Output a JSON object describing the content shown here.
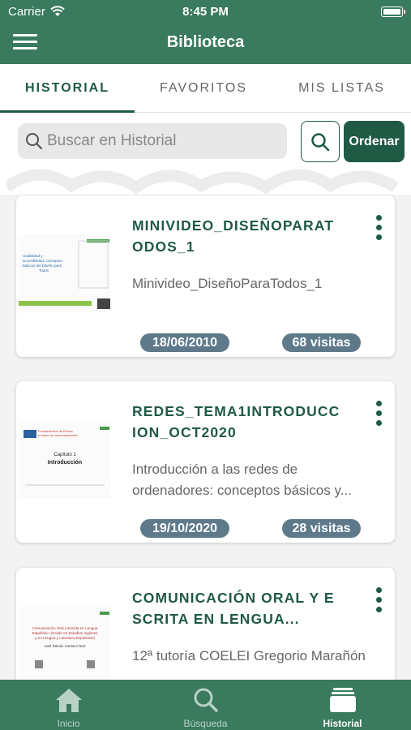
{
  "status_bar": {
    "carrier": "Carrier",
    "time": "8:45 PM"
  },
  "header": {
    "title": "Biblioteca",
    "menu_icon": "hamburger-menu-icon"
  },
  "tabs": [
    {
      "label": "HISTORIAL",
      "active": true
    },
    {
      "label": "FAVORITOS",
      "active": false
    },
    {
      "label": "MIS LISTAS",
      "active": false
    }
  ],
  "search": {
    "placeholder": "Buscar en Historial",
    "value": "",
    "button_icon": "search-icon",
    "order_label": "Ordenar"
  },
  "items": [
    {
      "title": "MINIVIDEO_DISEÑOPARATODOS_1",
      "description": "Minivideo_DiseñoParaTodos_1",
      "date": "18/06/2010",
      "visits": "68 visitas"
    },
    {
      "title": "REDES_TEMA1INTRODUCCION_OCT2020",
      "description": "Introducción a las redes de ordenadores: conceptos básicos y...",
      "date": "19/10/2020",
      "visits": "28 visitas"
    },
    {
      "title": "COMUNICACIÓN ORAL Y ESCRITA EN LENGUA...",
      "description": "12ª tutoría COELEI Gregorio Marañón",
      "date": "",
      "visits": ""
    }
  ],
  "thumbnails": {
    "t1": [
      "Usabilidad y",
      "accesibilidad: conceptos",
      "básicos del Diseño para",
      "Todos"
    ],
    "t2": [
      "Fundamentos de Redes",
      "y redes de comunicaciones",
      "Capítulo 1",
      "Introducción"
    ],
    "t3": [
      "Comunicación Oral y Escrita en Lengua",
      "Española I (Grado en Estudios Ingleses",
      "y en Lengua y Literatura Españolas)",
      "José Ramón Carriazo Ruiz"
    ]
  },
  "bottom_nav": [
    {
      "label": "Inicio",
      "icon": "home-icon",
      "active": false
    },
    {
      "label": "Búsqueda",
      "icon": "search-icon",
      "active": false
    },
    {
      "label": "Historial",
      "icon": "history-stack-icon",
      "active": true
    }
  ],
  "colors": {
    "primary": "#3a7a5e",
    "accent": "#1f5a44",
    "badge": "#5e7a8a"
  }
}
